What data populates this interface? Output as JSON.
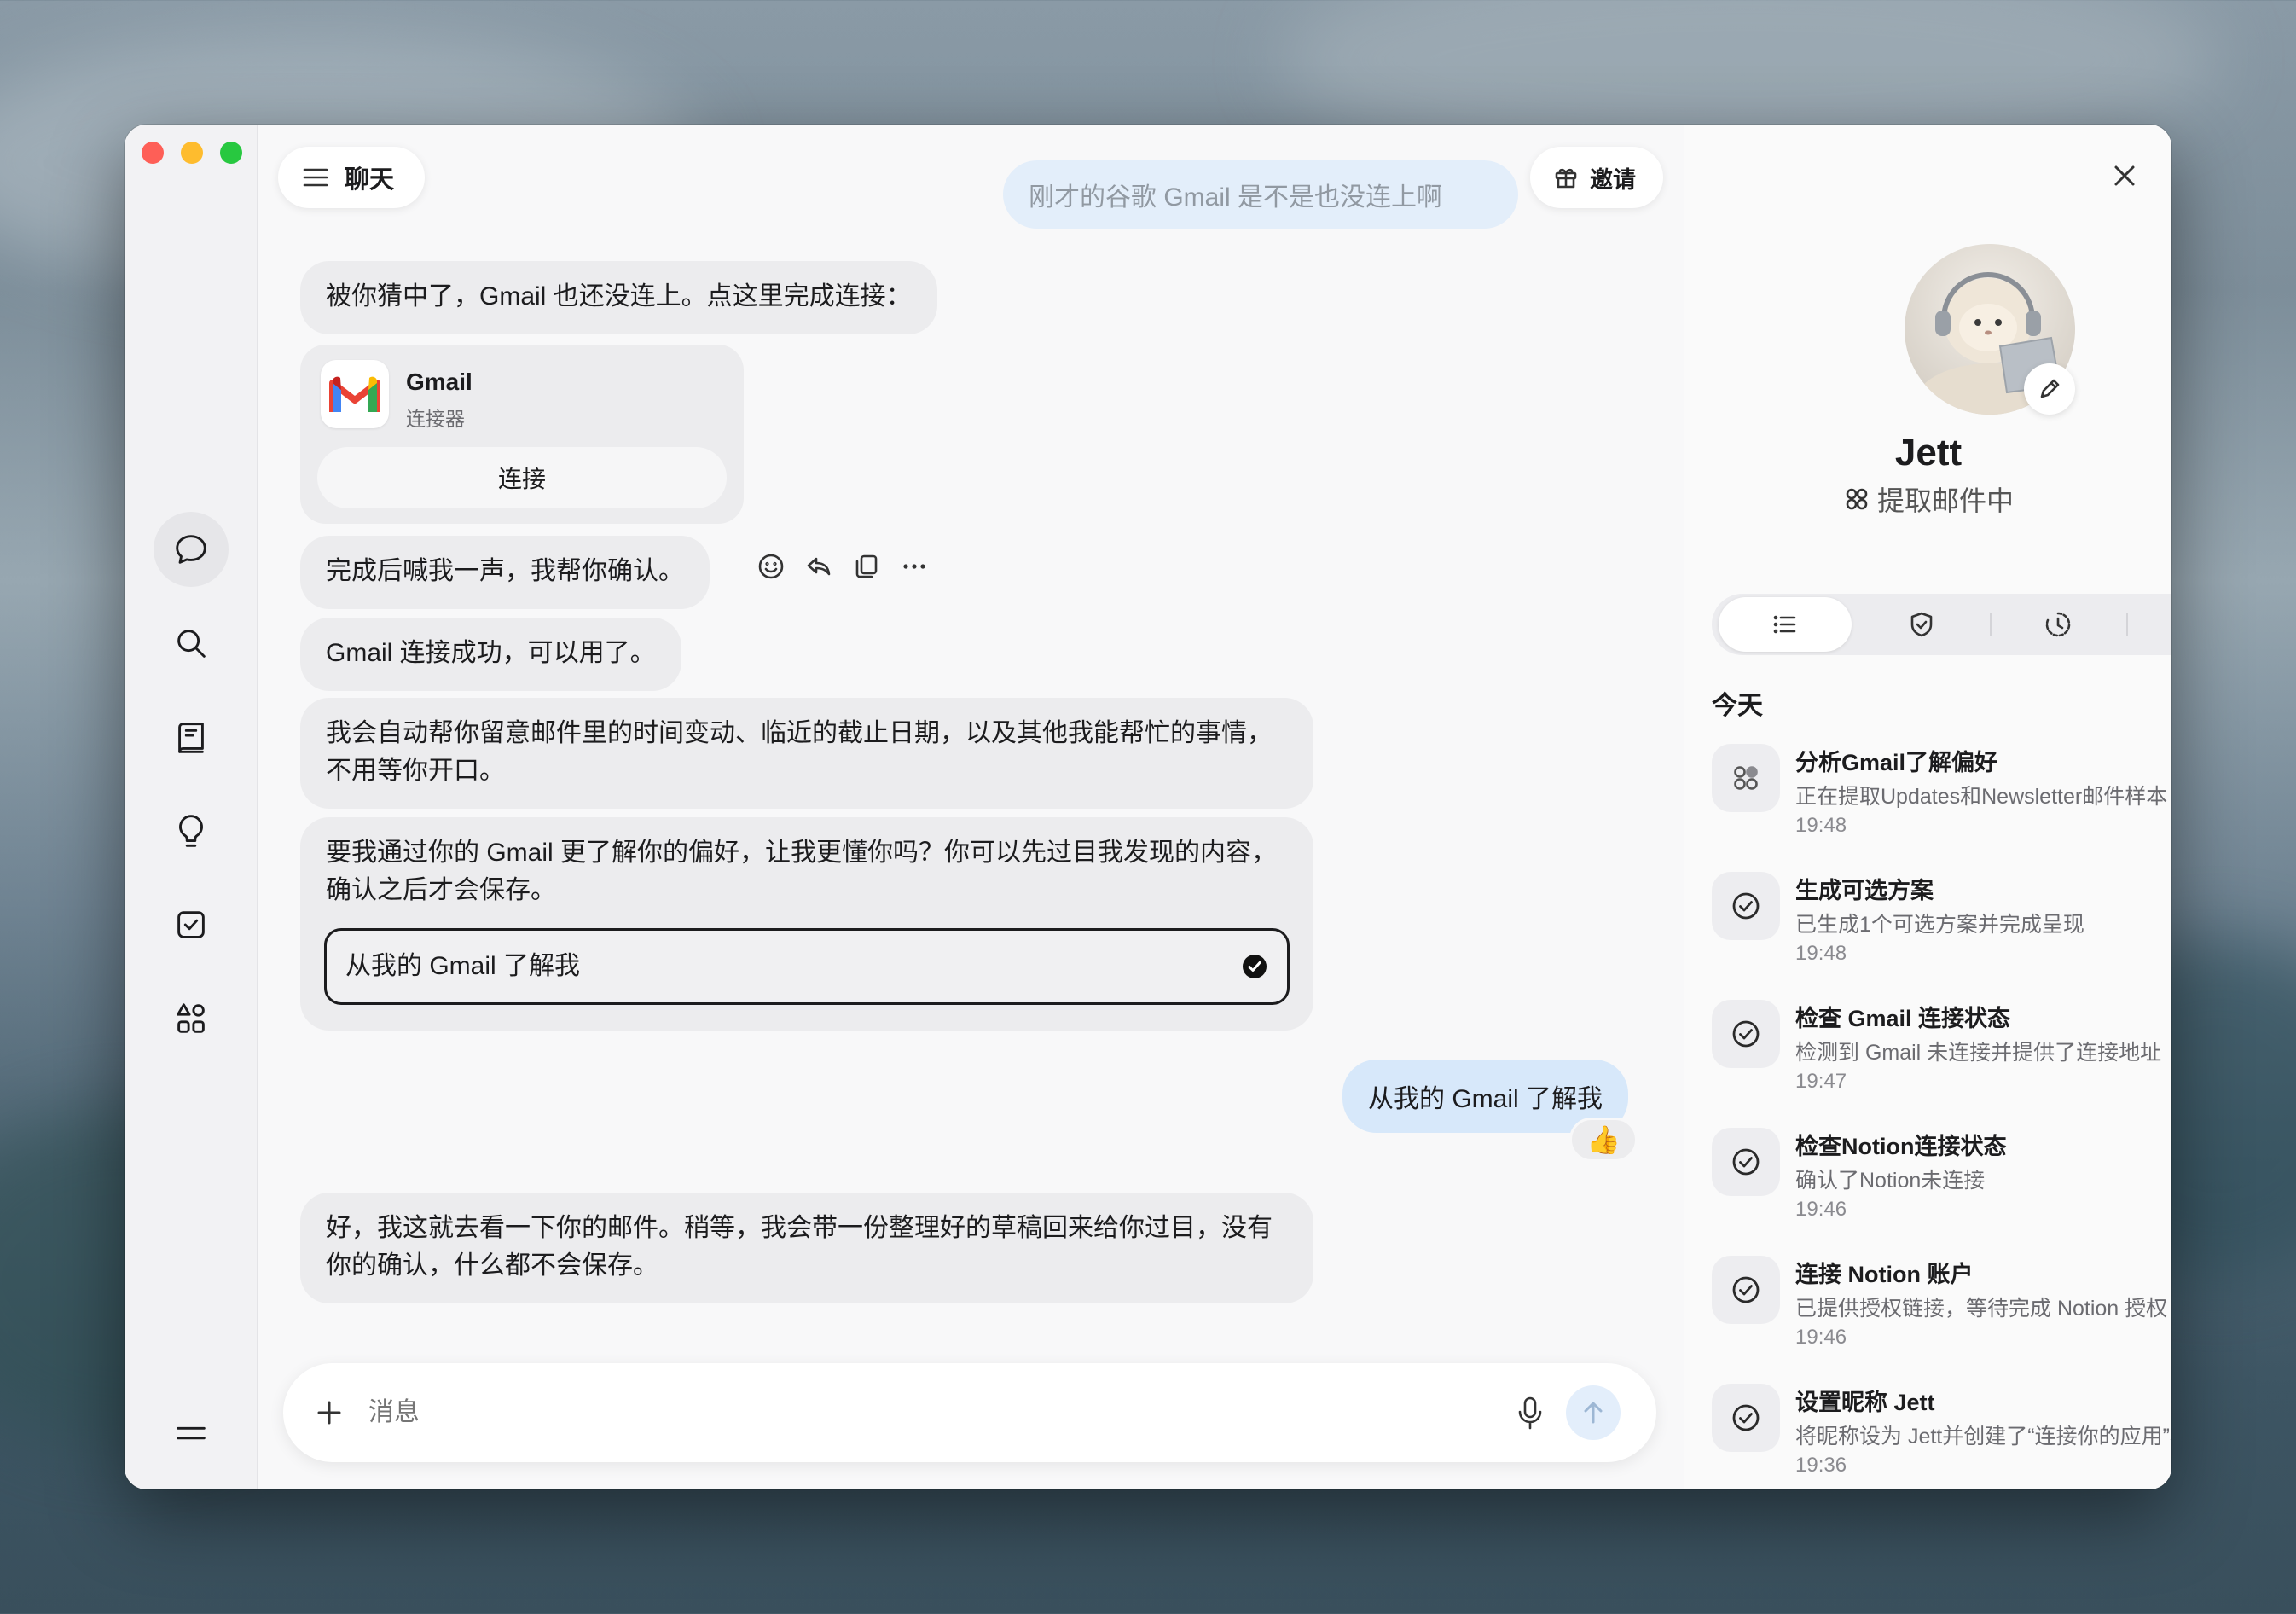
{
  "window": {
    "title": "聊天",
    "invite_label": "邀请"
  },
  "chat": {
    "faded_user_message": "刚才的谷歌 Gmail 是不是也没连上啊",
    "messages": {
      "m1": "被你猜中了，Gmail 也还没连上。点这里完成连接：",
      "connector_name": "Gmail",
      "connector_type": "连接器",
      "connect_button": "连接",
      "m2": "完成后喊我一声，我帮你确认。",
      "m3": "Gmail 连接成功，可以用了。",
      "m4": "我会自动帮你留意邮件里的时间变动、临近的截止日期，以及其他我能帮忙的事情，不用等你开口。",
      "m5": "要我通过你的 Gmail 更了解你的偏好，让我更懂你吗？你可以先过目我发现的内容，确认之后才会保存。",
      "m5_option": "从我的 Gmail 了解我",
      "user_reply": "从我的 Gmail 了解我",
      "user_reaction": "👍",
      "m6": "好，我这就去看一下你的邮件。稍等，我会带一份整理好的草稿回来给你过目，没有你的确认，什么都不会保存。"
    },
    "composer": {
      "placeholder": "消息"
    }
  },
  "agent": {
    "name": "Jett",
    "status": "提取邮件中",
    "section_title": "今天",
    "activities": [
      {
        "title": "分析Gmail了解偏好",
        "desc": "正在提取Updates和Newsletter邮件样本",
        "time": "19:48",
        "icon": "apps-icon"
      },
      {
        "title": "生成可选方案",
        "desc": "已生成1个可选方案并完成呈现",
        "time": "19:48",
        "icon": "check-circle-icon"
      },
      {
        "title": "检查 Gmail 连接状态",
        "desc": "检测到 Gmail 未连接并提供了连接地址",
        "time": "19:47",
        "icon": "check-circle-icon"
      },
      {
        "title": "检查Notion连接状态",
        "desc": "确认了Notion未连接",
        "time": "19:46",
        "icon": "check-circle-icon"
      },
      {
        "title": "连接 Notion 账户",
        "desc": "已提供授权链接，等待完成 Notion 授权",
        "time": "19:46",
        "icon": "check-circle-icon"
      },
      {
        "title": "设置昵称 Jett",
        "desc": "将昵称设为 Jett并创建了“连接你的应用”小组件",
        "time": "19:36",
        "icon": "check-circle-icon"
      }
    ]
  },
  "colors": {
    "user_bubble": "#d7e8fa",
    "assistant_bubble": "#ececee",
    "close_red": "#fe5f57",
    "minimize_yellow": "#febc2e",
    "zoom_green": "#28c840"
  }
}
